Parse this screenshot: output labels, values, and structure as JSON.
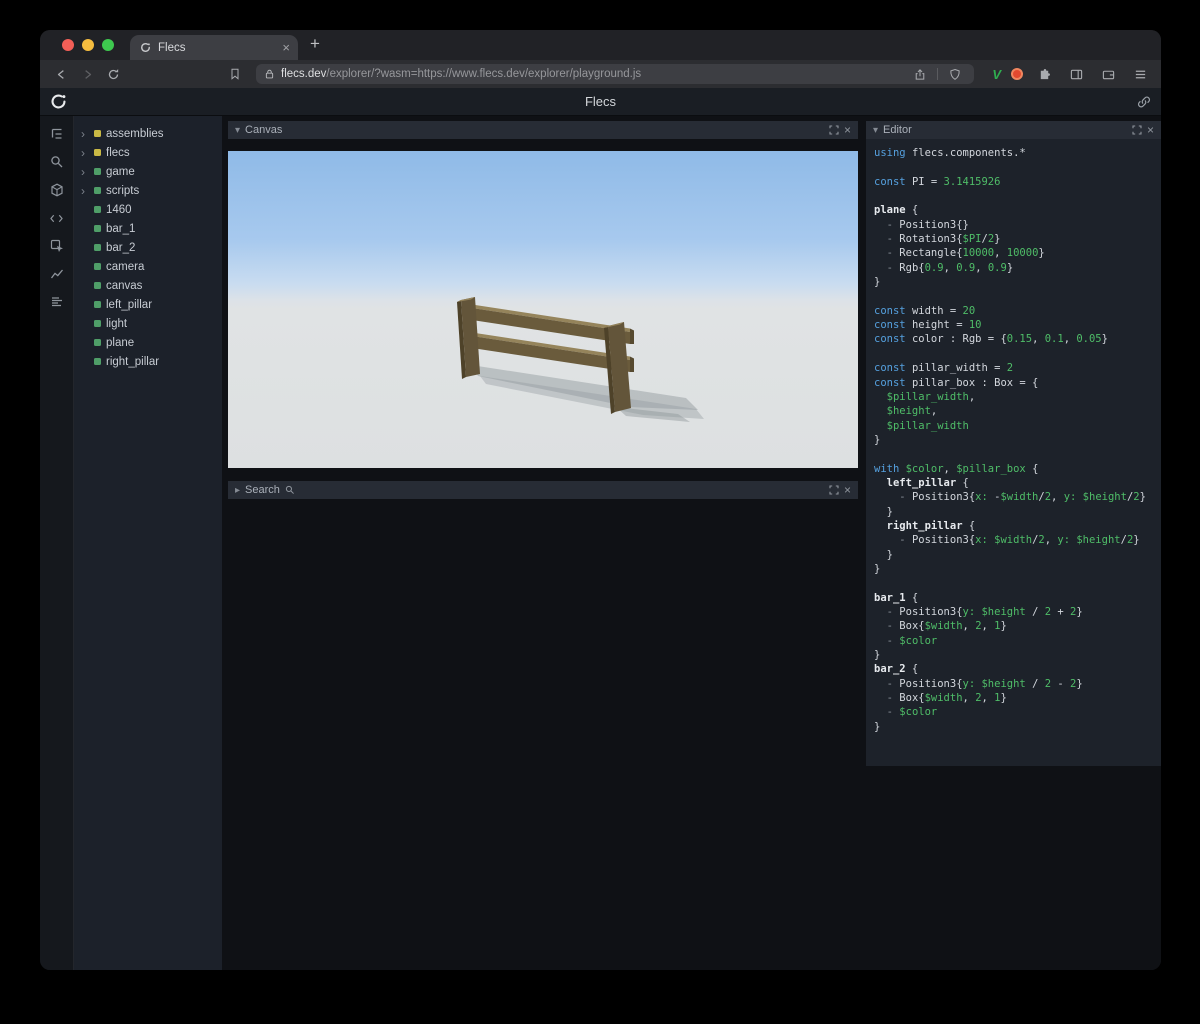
{
  "glyphs": {
    "close": "×",
    "plus": "+",
    "chevron_down": "▾",
    "chevron_right": "▸",
    "tree_arrow": "›",
    "v_logo": "V"
  },
  "browser": {
    "tab_title": "Flecs",
    "url_domain": "flecs.dev",
    "url_rest": "/explorer/?wasm=https://www.flecs.dev/explorer/playground.js"
  },
  "app": {
    "title": "Flecs",
    "tree": {
      "items": [
        {
          "label": "assemblies",
          "color": "#c9b945",
          "expandable": true
        },
        {
          "label": "flecs",
          "color": "#c9b945",
          "expandable": true
        },
        {
          "label": "game",
          "color": "#4f9e68",
          "expandable": true
        },
        {
          "label": "scripts",
          "color": "#4f9e68",
          "expandable": true
        },
        {
          "label": "1460",
          "color": "#4f9e68",
          "expandable": false
        },
        {
          "label": "bar_1",
          "color": "#4f9e68",
          "expandable": false
        },
        {
          "label": "bar_2",
          "color": "#4f9e68",
          "expandable": false
        },
        {
          "label": "camera",
          "color": "#4f9e68",
          "expandable": false
        },
        {
          "label": "canvas",
          "color": "#4f9e68",
          "expandable": false
        },
        {
          "label": "left_pillar",
          "color": "#4f9e68",
          "expandable": false
        },
        {
          "label": "light",
          "color": "#4f9e68",
          "expandable": false
        },
        {
          "label": "plane",
          "color": "#4f9e68",
          "expandable": false
        },
        {
          "label": "right_pillar",
          "color": "#4f9e68",
          "expandable": false
        }
      ]
    },
    "canvas_panel": {
      "title": "Canvas"
    },
    "search_panel": {
      "title": "Search"
    },
    "editor_panel": {
      "title": "Editor",
      "lines": [
        [
          [
            "k",
            "using "
          ],
          [
            "p",
            "flecs.components.*"
          ]
        ],
        [],
        [
          [
            "k",
            "const "
          ],
          [
            "p",
            "PI = "
          ],
          [
            "n",
            "3.1415926"
          ]
        ],
        [],
        [
          [
            "e",
            "plane"
          ],
          [
            "p",
            " {"
          ]
        ],
        [
          [
            "d",
            "  - "
          ],
          [
            "p",
            "Position3{}"
          ]
        ],
        [
          [
            "d",
            "  - "
          ],
          [
            "p",
            "Rotation3{"
          ],
          [
            "v",
            "$PI"
          ],
          [
            "p",
            "/"
          ],
          [
            "n",
            "2"
          ],
          [
            "p",
            "}"
          ]
        ],
        [
          [
            "d",
            "  - "
          ],
          [
            "p",
            "Rectangle{"
          ],
          [
            "n",
            "10000"
          ],
          [
            "p",
            ", "
          ],
          [
            "n",
            "10000"
          ],
          [
            "p",
            "}"
          ]
        ],
        [
          [
            "d",
            "  - "
          ],
          [
            "p",
            "Rgb{"
          ],
          [
            "n",
            "0.9"
          ],
          [
            "p",
            ", "
          ],
          [
            "n",
            "0.9"
          ],
          [
            "p",
            ", "
          ],
          [
            "n",
            "0.9"
          ],
          [
            "p",
            "}"
          ]
        ],
        [
          [
            "p",
            "}"
          ]
        ],
        [],
        [
          [
            "k",
            "const "
          ],
          [
            "p",
            "width = "
          ],
          [
            "n",
            "20"
          ]
        ],
        [
          [
            "k",
            "const "
          ],
          [
            "p",
            "height = "
          ],
          [
            "n",
            "10"
          ]
        ],
        [
          [
            "k",
            "const "
          ],
          [
            "p",
            "color : Rgb = {"
          ],
          [
            "n",
            "0.15"
          ],
          [
            "p",
            ", "
          ],
          [
            "n",
            "0.1"
          ],
          [
            "p",
            ", "
          ],
          [
            "n",
            "0.05"
          ],
          [
            "p",
            "}"
          ]
        ],
        [],
        [
          [
            "k",
            "const "
          ],
          [
            "p",
            "pillar_width = "
          ],
          [
            "n",
            "2"
          ]
        ],
        [
          [
            "k",
            "const "
          ],
          [
            "p",
            "pillar_box : Box = {"
          ]
        ],
        [
          [
            "v",
            "  $pillar_width"
          ],
          [
            "p",
            ","
          ]
        ],
        [
          [
            "v",
            "  $height"
          ],
          [
            "p",
            ","
          ]
        ],
        [
          [
            "v",
            "  $pillar_width"
          ]
        ],
        [
          [
            "p",
            "}"
          ]
        ],
        [],
        [
          [
            "k",
            "with "
          ],
          [
            "v",
            "$color"
          ],
          [
            "p",
            ", "
          ],
          [
            "v",
            "$pillar_box"
          ],
          [
            "p",
            " {"
          ]
        ],
        [
          [
            "p",
            "  "
          ],
          [
            "e",
            "left_pillar"
          ],
          [
            "p",
            " {"
          ]
        ],
        [
          [
            "d",
            "    - "
          ],
          [
            "p",
            "Position3{"
          ],
          [
            "g",
            "x: "
          ],
          [
            "p",
            "-"
          ],
          [
            "v",
            "$width"
          ],
          [
            "p",
            "/"
          ],
          [
            "n",
            "2"
          ],
          [
            "p",
            ", "
          ],
          [
            "g",
            "y: "
          ],
          [
            "v",
            "$height"
          ],
          [
            "p",
            "/"
          ],
          [
            "n",
            "2"
          ],
          [
            "p",
            "}"
          ]
        ],
        [
          [
            "p",
            "  }"
          ]
        ],
        [
          [
            "p",
            "  "
          ],
          [
            "e",
            "right_pillar"
          ],
          [
            "p",
            " {"
          ]
        ],
        [
          [
            "d",
            "    - "
          ],
          [
            "p",
            "Position3{"
          ],
          [
            "g",
            "x: "
          ],
          [
            "v",
            "$width"
          ],
          [
            "p",
            "/"
          ],
          [
            "n",
            "2"
          ],
          [
            "p",
            ", "
          ],
          [
            "g",
            "y: "
          ],
          [
            "v",
            "$height"
          ],
          [
            "p",
            "/"
          ],
          [
            "n",
            "2"
          ],
          [
            "p",
            "}"
          ]
        ],
        [
          [
            "p",
            "  }"
          ]
        ],
        [
          [
            "p",
            "}"
          ]
        ],
        [],
        [
          [
            "e",
            "bar_1"
          ],
          [
            "p",
            " {"
          ]
        ],
        [
          [
            "d",
            "  - "
          ],
          [
            "p",
            "Position3{"
          ],
          [
            "g",
            "y: "
          ],
          [
            "v",
            "$height"
          ],
          [
            "p",
            " / "
          ],
          [
            "n",
            "2"
          ],
          [
            "p",
            " + "
          ],
          [
            "n",
            "2"
          ],
          [
            "p",
            "}"
          ]
        ],
        [
          [
            "d",
            "  - "
          ],
          [
            "p",
            "Box{"
          ],
          [
            "v",
            "$width"
          ],
          [
            "p",
            ", "
          ],
          [
            "n",
            "2"
          ],
          [
            "p",
            ", "
          ],
          [
            "n",
            "1"
          ],
          [
            "p",
            "}"
          ]
        ],
        [
          [
            "d",
            "  - "
          ],
          [
            "v",
            "$color"
          ]
        ],
        [
          [
            "p",
            "}"
          ]
        ],
        [
          [
            "e",
            "bar_2"
          ],
          [
            "p",
            " {"
          ]
        ],
        [
          [
            "d",
            "  - "
          ],
          [
            "p",
            "Position3{"
          ],
          [
            "g",
            "y: "
          ],
          [
            "v",
            "$height"
          ],
          [
            "p",
            " / "
          ],
          [
            "n",
            "2"
          ],
          [
            "p",
            " - "
          ],
          [
            "n",
            "2"
          ],
          [
            "p",
            "}"
          ]
        ],
        [
          [
            "d",
            "  - "
          ],
          [
            "p",
            "Box{"
          ],
          [
            "v",
            "$width"
          ],
          [
            "p",
            ", "
          ],
          [
            "n",
            "2"
          ],
          [
            "p",
            ", "
          ],
          [
            "n",
            "1"
          ],
          [
            "p",
            "}"
          ]
        ],
        [
          [
            "d",
            "  - "
          ],
          [
            "v",
            "$color"
          ]
        ],
        [
          [
            "p",
            "}"
          ]
        ]
      ]
    }
  }
}
